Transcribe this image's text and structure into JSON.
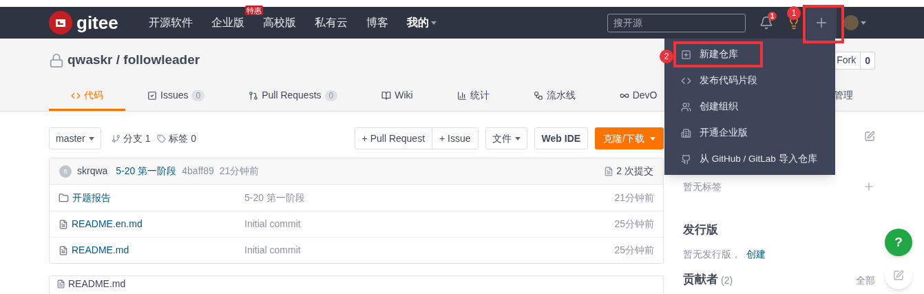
{
  "nav": {
    "logo": "gitee",
    "items": [
      {
        "label": "开源软件"
      },
      {
        "label": "企业版",
        "badge": "特惠"
      },
      {
        "label": "高校版"
      },
      {
        "label": "私有云"
      },
      {
        "label": "博客"
      }
    ],
    "account": "我的"
  },
  "search": {
    "placeholder": "搜开源"
  },
  "notifications": {
    "count": "1"
  },
  "annotations": [
    {
      "label": "1"
    },
    {
      "label": "2"
    }
  ],
  "repo": {
    "owner": "qwaskr",
    "separator": "/",
    "name": "followleader",
    "locked": true
  },
  "fork": {
    "label": "Fork",
    "count": "0"
  },
  "tabs": [
    {
      "label": "代码",
      "kind": "code",
      "selected": true
    },
    {
      "label": "Issues",
      "kind": "issues",
      "count": "0",
      "selected": false
    },
    {
      "label": "Pull Requests",
      "kind": "pulls",
      "count": "0",
      "selected": false
    },
    {
      "label": "Wiki",
      "kind": "wiki",
      "selected": false
    },
    {
      "label": "统计",
      "kind": "stats",
      "selected": false
    },
    {
      "label": "流水线",
      "kind": "pipeline",
      "selected": false
    },
    {
      "label": "DevO",
      "kind": "devops",
      "selected": false
    },
    {
      "label": "管理",
      "kind": "manage",
      "selected": false
    }
  ],
  "create_menu": [
    {
      "label": "新建仓库",
      "kind": "new-repo",
      "highlighted": true
    },
    {
      "label": "发布代码片段",
      "kind": "snippet",
      "highlighted": false
    },
    {
      "label": "创建组织",
      "kind": "org",
      "highlighted": false
    },
    {
      "label": "开通企业版",
      "kind": "enterprise",
      "highlighted": false
    },
    {
      "label": "从 GitHub / GitLab 导入仓库",
      "kind": "import",
      "highlighted": false
    }
  ],
  "toolbar": {
    "branch": "master",
    "branches": "分支 1",
    "tags": "标签 0",
    "pull_request": "+ Pull Request",
    "issue": "+ Issue",
    "files": "文件",
    "web_ide": "Web IDE",
    "clone": "克隆/下载"
  },
  "commit": {
    "avatar": "s",
    "author": "skrqwa",
    "message": "5-20 第一阶段",
    "hash": "4baff89",
    "time": "21分钟前",
    "count": "2 次提交"
  },
  "files": [
    {
      "name": "开题报告",
      "kind": "folder",
      "message": "5-20 第一阶段",
      "time": "21分钟前"
    },
    {
      "name": "README.en.md",
      "kind": "file",
      "message": "Initial commit",
      "time": "25分钟前"
    },
    {
      "name": "README.md",
      "kind": "file",
      "message": "Initial commit",
      "time": "25分钟前"
    }
  ],
  "readme": {
    "title": "README.md"
  },
  "sidebar": {
    "tags_empty": "暂无标签",
    "releases": "发行版",
    "releases_empty": "暂无发行版，",
    "releases_create": "创建",
    "contributors": "贡献者",
    "contributors_count": "(2)",
    "contributors_all": "全部"
  },
  "help": {
    "label": "?"
  }
}
